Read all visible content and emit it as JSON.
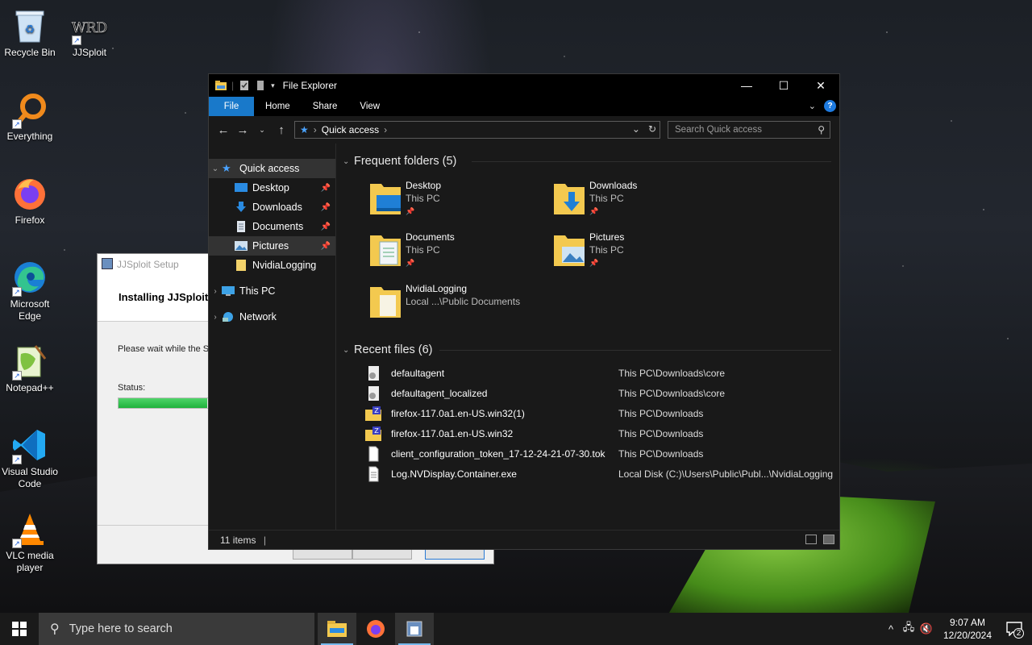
{
  "desktop": {
    "icons": [
      {
        "label": "Recycle Bin",
        "icon": "recycle-bin-icon"
      },
      {
        "label": "JJSploit",
        "icon": "jjsploit-icon",
        "logo_text": "WRD"
      },
      {
        "label": "Everything",
        "icon": "everything-search-icon"
      },
      {
        "label": "Firefox",
        "icon": "firefox-icon"
      },
      {
        "label": "Microsoft Edge",
        "icon": "edge-icon"
      },
      {
        "label": "Notepad++",
        "icon": "notepad-plus-plus-icon"
      },
      {
        "label": "Visual Studio Code",
        "icon": "vscode-icon"
      },
      {
        "label": "VLC media player",
        "icon": "vlc-icon"
      }
    ]
  },
  "setup_window": {
    "title": "JJSploit Setup",
    "heading": "Installing JJSploit",
    "message": "Please wait while the Se",
    "status_label": "Status:",
    "progress": 0.25
  },
  "explorer": {
    "title": "File Explorer",
    "ribbon_tabs": [
      "File",
      "Home",
      "Share",
      "View"
    ],
    "address": "Quick access",
    "search_placeholder": "Search Quick access",
    "nav": {
      "quick_access": "Quick access",
      "pinned": [
        "Desktop",
        "Downloads",
        "Documents",
        "Pictures"
      ],
      "unpinned": "NvidiaLogging",
      "this_pc": "This PC",
      "network": "Network"
    },
    "frequent_header": "Frequent folders (5)",
    "folders": [
      {
        "name": "Desktop",
        "location": "This PC",
        "pinned": true
      },
      {
        "name": "Downloads",
        "location": "This PC",
        "pinned": true
      },
      {
        "name": "Documents",
        "location": "This PC",
        "pinned": true
      },
      {
        "name": "Pictures",
        "location": "This PC",
        "pinned": true
      },
      {
        "name": "NvidiaLogging",
        "location": "Local ...\\Public Documents",
        "pinned": false
      }
    ],
    "recent_header": "Recent files (6)",
    "recent_files": [
      {
        "name": "defaultagent",
        "location": "This PC\\Downloads\\core",
        "icon": "gear-file-icon"
      },
      {
        "name": "defaultagent_localized",
        "location": "This PC\\Downloads\\core",
        "icon": "gear-file-icon"
      },
      {
        "name": "firefox-117.0a1.en-US.win32(1)",
        "location": "This PC\\Downloads",
        "icon": "zip-folder-icon"
      },
      {
        "name": "firefox-117.0a1.en-US.win32",
        "location": "This PC\\Downloads",
        "icon": "zip-folder-icon"
      },
      {
        "name": "client_configuration_token_17-12-24-21-07-30.tok",
        "location": "This PC\\Downloads",
        "icon": "blank-file-icon"
      },
      {
        "name": "Log.NVDisplay.Container.exe",
        "location": "Local Disk (C:)\\Users\\Public\\Publ...\\NvidiaLogging",
        "icon": "text-file-icon"
      }
    ],
    "status": "11 items"
  },
  "taskbar": {
    "search_placeholder": "Type here to search",
    "time": "9:07 AM",
    "date": "12/20/2024",
    "notification_count": "2"
  }
}
